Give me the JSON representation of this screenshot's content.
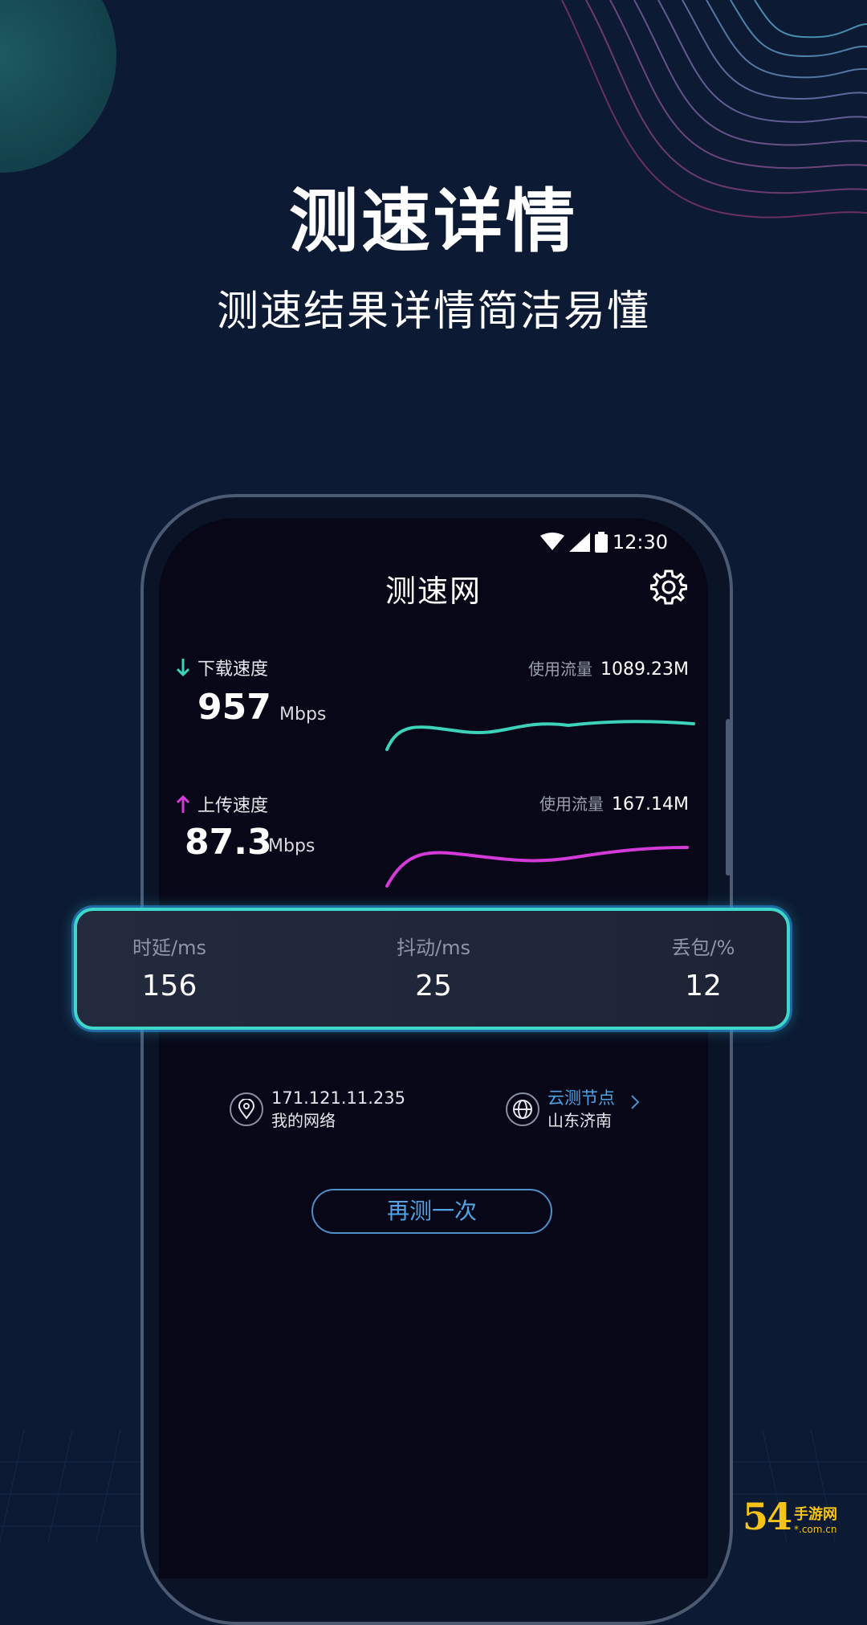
{
  "hero": {
    "title": "测速详情",
    "subtitle": "测速结果详情简洁易懂"
  },
  "statusbar": {
    "time": "12:30",
    "icons": [
      "wifi-icon",
      "signal-icon",
      "battery-icon"
    ]
  },
  "app": {
    "title": "测速网",
    "settings_icon": "gear-icon"
  },
  "download": {
    "label": "下载速度",
    "value": "957",
    "unit": "Mbps",
    "usage_label": "使用流量",
    "usage_value": "1089.23M",
    "color": "#3cd3b8"
  },
  "upload": {
    "label": "上传速度",
    "value": "87.3",
    "unit": "Mbps",
    "usage_label": "使用流量",
    "usage_value": "167.14M",
    "color": "#d43ad8"
  },
  "stats": [
    {
      "label": "时延/ms",
      "value": "156"
    },
    {
      "label": "抖动/ms",
      "value": "25"
    },
    {
      "label": "丢包/%",
      "value": "12"
    }
  ],
  "network": {
    "ip": "171.121.11.235",
    "name": "我的网络",
    "icon": "location-pin-icon"
  },
  "node": {
    "label": "云测节点",
    "location": "山东济南",
    "icon": "globe-icon"
  },
  "retest_label": "再测一次",
  "watermark": {
    "big": "54",
    "brand": "手游网",
    "domain": "*.com.cn"
  }
}
